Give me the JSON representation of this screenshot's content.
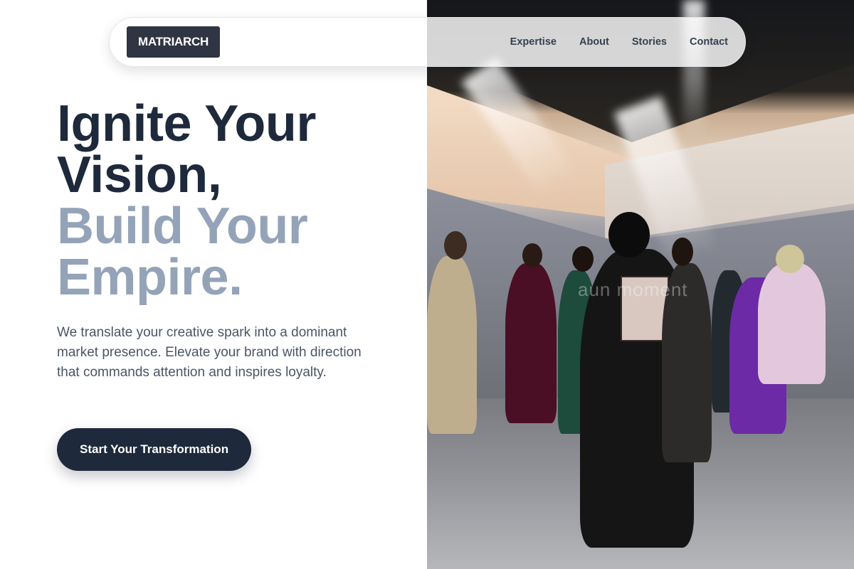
{
  "brand": {
    "logo_text": "MATRIARCH"
  },
  "nav": {
    "links": [
      {
        "label": "Expertise"
      },
      {
        "label": "About"
      },
      {
        "label": "Stories"
      },
      {
        "label": "Contact"
      }
    ]
  },
  "hero": {
    "headline_line1": "Ignite Your",
    "headline_line2": "Vision,",
    "headline_line3": "Build Your",
    "headline_line4": "Empire.",
    "lead": "We translate your creative spark into a dominant market presence. Elevate your brand with direction that commands attention and inspires loyalty.",
    "cta_label": "Start Your Transformation"
  },
  "photo": {
    "subject": "fashion-show-models-under-spotlights",
    "watermark_text": "aun moment"
  },
  "colors": {
    "primary_dark": "#1e293b",
    "headline_muted": "#94a3b8",
    "body_text": "#4b5563",
    "logo_bg": "#2f3542"
  }
}
